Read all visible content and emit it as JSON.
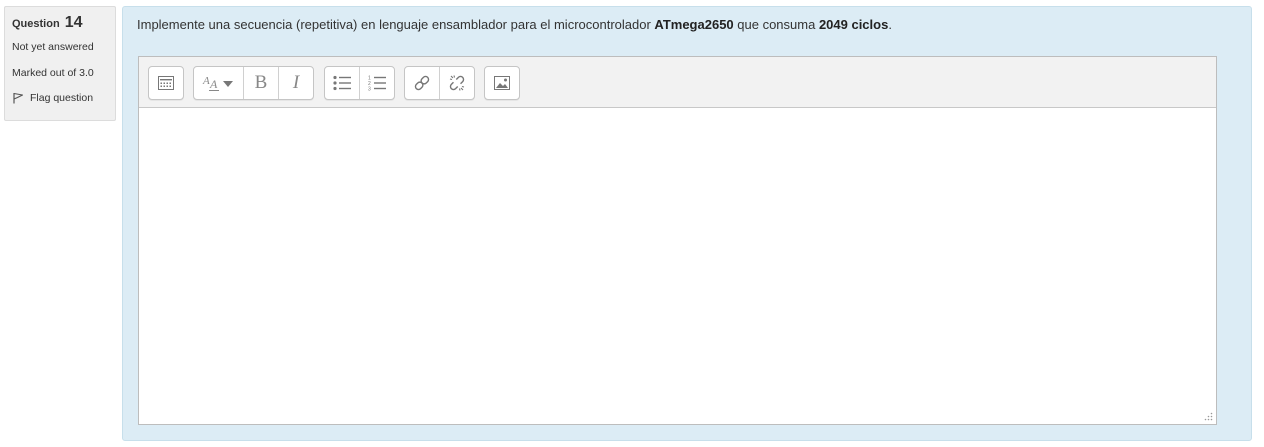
{
  "question": {
    "label": "Question",
    "number": "14",
    "state": "Not yet answered",
    "grade": "Marked out of 3.0",
    "flag_label": "Flag question"
  },
  "prompt": {
    "part1": "Implemente una secuencia (repetitiva) en lenguaje ensamblador para el microcontrolador ",
    "bold1": "ATmega2650",
    "part2": " que consuma ",
    "bold2": "2049 ciclos",
    "part3": "."
  },
  "toolbar": {
    "groups": [
      [
        "toolbar-toggle-icon"
      ],
      [
        "font-style-icon",
        "bold-icon",
        "italic-icon"
      ],
      [
        "unordered-list-icon",
        "ordered-list-icon"
      ],
      [
        "link-icon",
        "unlink-icon"
      ],
      [
        "image-icon"
      ]
    ],
    "bold_label": "B",
    "italic_label": "I"
  },
  "colors": {
    "content_bg": "#dcecf5",
    "info_bg": "#f0f0f0",
    "toolbar_bg": "#f2f2f2"
  }
}
